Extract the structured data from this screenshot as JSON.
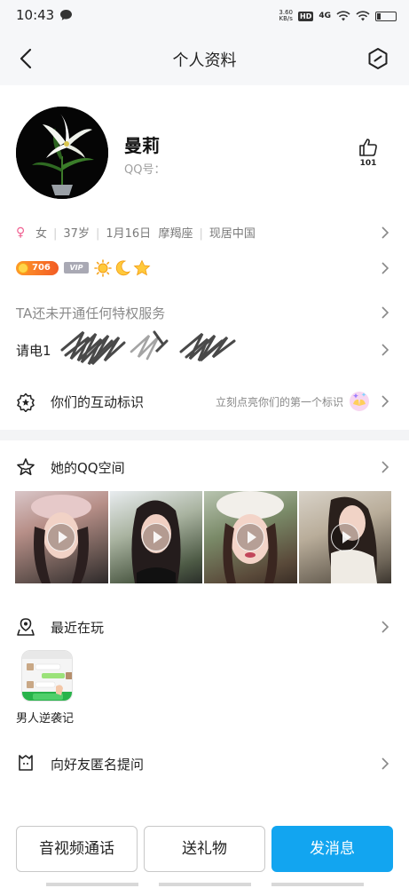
{
  "status_bar": {
    "time": "10:43",
    "net_speed_top": "3.60",
    "net_speed_bottom": "KB/s",
    "hd": "HD",
    "signal": "4G",
    "battery": "1"
  },
  "nav": {
    "title": "个人资料"
  },
  "profile": {
    "nickname": "曼莉",
    "qq_label": "QQ号：",
    "likes": "101"
  },
  "info": {
    "gender": "女",
    "age": "37岁",
    "birthday": "1月16日",
    "zodiac": "摩羯座",
    "location": "现居中国"
  },
  "level": {
    "value": "706",
    "vip": "VIP"
  },
  "privilege_text": "TA还未开通任何特权服务",
  "signature_text": "请电1",
  "interaction": {
    "label": "你们的互动标识",
    "hint": "立刻点亮你们的第一个标识"
  },
  "qzone": {
    "label": "她的QQ空间"
  },
  "recent": {
    "label": "最近在玩",
    "game_name": "男人逆袭记"
  },
  "ask": {
    "label": "向好友匿名提问"
  },
  "actions": {
    "call": "音视频通话",
    "gift": "送礼物",
    "message": "发消息"
  },
  "colors": {
    "primary": "#12a5f0",
    "level_badge": "#f25b24",
    "gender": "#f06292"
  }
}
